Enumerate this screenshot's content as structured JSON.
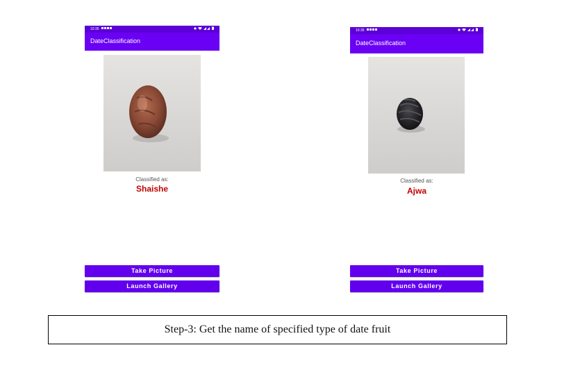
{
  "screens": [
    {
      "status_time": "10:35",
      "app_title": "DateClassification",
      "image_subject": "date-fruit-shaishe",
      "classified_label": "Classified as:",
      "result": "Shaishe",
      "take_picture_label": "Take Picture",
      "launch_gallery_label": "Launch Gallery"
    },
    {
      "status_time": "10:35",
      "app_title": "DateClassification",
      "image_subject": "date-fruit-ajwa",
      "classified_label": "Classified as:",
      "result": "Ajwa",
      "take_picture_label": "Take Picture",
      "launch_gallery_label": "Launch Gallery"
    }
  ],
  "caption": "Step-3: Get the name of specified type of date fruit",
  "colors": {
    "app_bar": "#6a00f4",
    "status_bar": "#5b00d6",
    "button": "#6200ee",
    "result_text": "#c00000"
  },
  "icons": [
    "wifi-icon",
    "signal-icon",
    "battery-icon",
    "notification-icon"
  ]
}
